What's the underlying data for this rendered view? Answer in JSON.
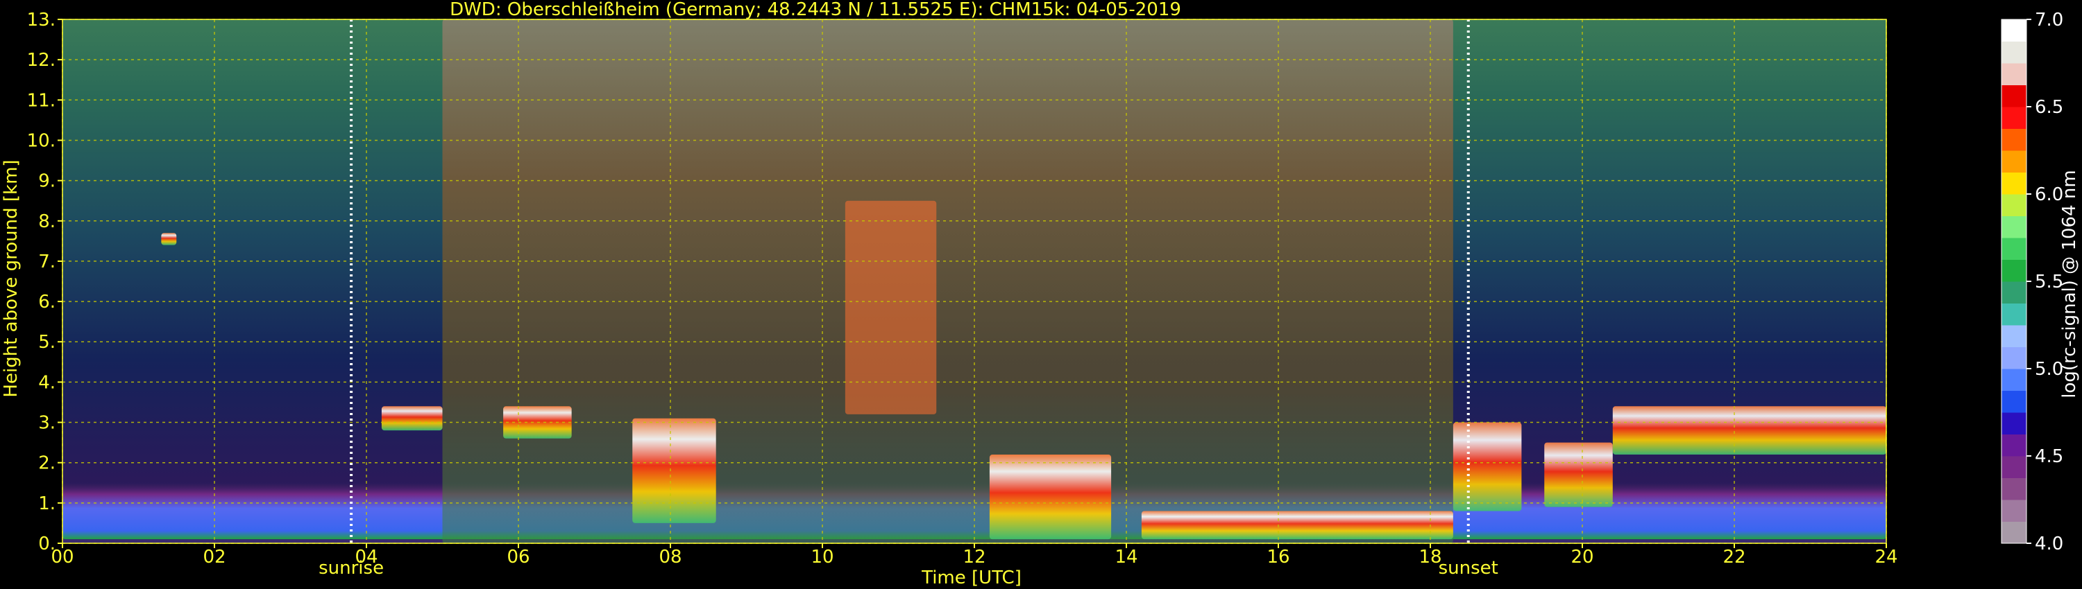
{
  "title": "DWD: Oberschleißheim (Germany; 48.2443 N / 11.5525 E):    CHM15k: 04-05-2019",
  "colors": {
    "axis_text": "#ffff33",
    "grid": "#c8c800",
    "background": "#000000",
    "colorbar_text": "#ffffff"
  },
  "chart_data": {
    "type": "heatmap",
    "title": "DWD: Oberschleißheim (Germany; 48.2443 N / 11.5525 E):    CHM15k: 04-05-2019",
    "xlabel": "Time [UTC]",
    "ylabel": "Height above ground [km]",
    "xlim": [
      0,
      24
    ],
    "ylim": [
      0,
      13
    ],
    "x_ticks": [
      0,
      2,
      4,
      6,
      8,
      10,
      12,
      14,
      16,
      18,
      20,
      22,
      24
    ],
    "x_tick_labels": [
      "00",
      "02",
      "04",
      "06",
      "08",
      "10",
      "12",
      "14",
      "16",
      "18",
      "20",
      "22",
      "24"
    ],
    "y_ticks": [
      0,
      1,
      2,
      3,
      4,
      5,
      6,
      7,
      8,
      9,
      10,
      11,
      12,
      13
    ],
    "y_tick_labels": [
      "0.",
      "1.",
      "2.",
      "3.",
      "4.",
      "5.",
      "6.",
      "7.",
      "8.",
      "9.",
      "10.",
      "11.",
      "12.",
      "13."
    ],
    "grid": true,
    "annotations": [
      {
        "label": "sunrise",
        "x": 3.8
      },
      {
        "label": "sunset",
        "x": 18.5
      }
    ],
    "colorbar": {
      "label": "log(rc-signal) @ 1064 nm",
      "range": [
        4.0,
        7.0
      ],
      "tick_values": [
        4.0,
        4.5,
        5.0,
        5.5,
        6.0,
        6.5,
        7.0
      ],
      "tick_labels": [
        "4.0",
        "4.5",
        "5.0",
        "5.5",
        "6.0",
        "6.5",
        "7.0"
      ],
      "colors": [
        "#a89aa8",
        "#a07aa0",
        "#8a4a8a",
        "#7a2a8a",
        "#6a1a9a",
        "#2a10c0",
        "#2050f0",
        "#5080ff",
        "#90a8ff",
        "#a0c0ff",
        "#40c0b0",
        "#30a070",
        "#20b040",
        "#40d060",
        "#80f080",
        "#c0f040",
        "#ffe000",
        "#ffa000",
        "#ff6000",
        "#ff1010",
        "#e80000",
        "#f0c8c0",
        "#e8e8e0",
        "#ffffff"
      ]
    },
    "layers": [
      {
        "name": "boundary layer aerosol",
        "x_range": [
          0,
          24
        ],
        "height_km": [
          0.1,
          1.5
        ]
      },
      {
        "name": "daytime residual noise",
        "x_range": [
          5,
          18.3
        ],
        "height_km": [
          0,
          13
        ]
      },
      {
        "name": "cloud",
        "x_range": [
          4.2,
          5.0
        ],
        "height_km": [
          2.8,
          3.4
        ]
      },
      {
        "name": "cloud",
        "x_range": [
          5.8,
          6.7
        ],
        "height_km": [
          2.6,
          3.4
        ]
      },
      {
        "name": "cloud",
        "x_range": [
          7.5,
          8.6
        ],
        "height_km": [
          0.5,
          3.1
        ]
      },
      {
        "name": "cirrus",
        "x_range": [
          10.3,
          11.5
        ],
        "height_km": [
          3.2,
          8.5
        ]
      },
      {
        "name": "cloud",
        "x_range": [
          12.2,
          13.8
        ],
        "height_km": [
          0.1,
          2.2
        ]
      },
      {
        "name": "cloud",
        "x_range": [
          14.2,
          18.3
        ],
        "height_km": [
          0.1,
          0.8
        ]
      },
      {
        "name": "cloud",
        "x_range": [
          18.3,
          19.2
        ],
        "height_km": [
          0.8,
          3.0
        ]
      },
      {
        "name": "cloud",
        "x_range": [
          19.5,
          20.4
        ],
        "height_km": [
          0.9,
          2.5
        ]
      },
      {
        "name": "cloud",
        "x_range": [
          20.4,
          24
        ],
        "height_km": [
          2.2,
          3.4
        ]
      },
      {
        "name": "small cloud",
        "x_range": [
          1.3,
          1.5
        ],
        "height_km": [
          7.4,
          7.7
        ]
      }
    ]
  }
}
